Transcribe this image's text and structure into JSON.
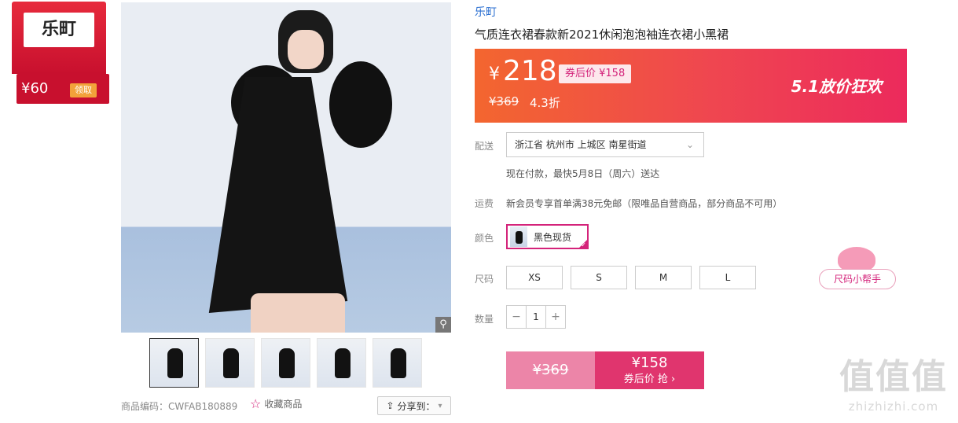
{
  "coupon": {
    "brand_logo": "乐町",
    "amount": "¥60",
    "claim_label": "领取"
  },
  "product": {
    "brand": "乐町",
    "title": "气质连衣裙春款新2021休闲泡泡袖连衣裙小黑裙",
    "price_symbol": "¥",
    "price": "218",
    "coupon_price": "券后价 ¥158",
    "original_price": "¥369",
    "discount": "4.3折",
    "promo": "5.1放价狂欢"
  },
  "delivery": {
    "label": "配送",
    "address": "浙江省 杭州市 上城区 南星街道",
    "note": "现在付款，最快5月8日（周六）送达"
  },
  "shipping": {
    "label": "运费",
    "text": "新会员专享首单满38元免邮（限唯品自营商品，部分商品不可用）"
  },
  "color": {
    "label": "颜色",
    "option": "黑色现货"
  },
  "size": {
    "label": "尺码",
    "options": [
      "XS",
      "S",
      "M",
      "L"
    ],
    "helper": "尺码小帮手"
  },
  "quantity": {
    "label": "数量",
    "minus": "−",
    "value": "1",
    "plus": "+"
  },
  "buy": {
    "old_price": "¥369",
    "new_price": "¥158",
    "action": "券后价 抢 ›"
  },
  "meta": {
    "goods_code": "商品编码：CWFAB180889",
    "favorite": "收藏商品",
    "share": "分享到："
  },
  "watermark": {
    "big": "值值值",
    "small": "zhizhizhi.com"
  },
  "colors": {
    "accent": "#d4237a",
    "banner_start": "#f3662f",
    "banner_end": "#ec2a5c",
    "brand_link": "#2b6fd1"
  }
}
